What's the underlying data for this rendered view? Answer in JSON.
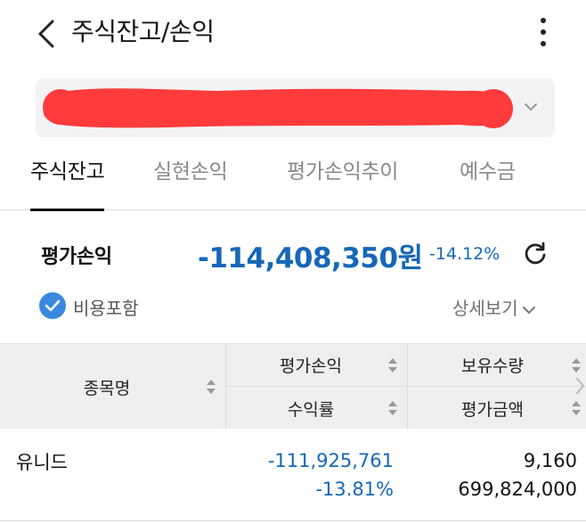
{
  "header": {
    "title": "주식잔고/손익",
    "back_icon": "chevron-left-icon",
    "more_icon": "more-vertical-icon"
  },
  "account": {
    "chevron_icon": "chevron-down-icon",
    "mask_color": "#ff3b3b"
  },
  "tabs": [
    {
      "label": "주식잔고",
      "active": true
    },
    {
      "label": "실현손익",
      "active": false
    },
    {
      "label": "평가손익추이",
      "active": false
    },
    {
      "label": "예수금",
      "active": false
    }
  ],
  "summary": {
    "label": "평가손익",
    "value": "-114,408,350원",
    "rate": "-14.12%",
    "refresh_icon": "refresh-icon"
  },
  "options": {
    "include_fees_label": "비용포함",
    "include_fees_checked": true,
    "detail_label": "상세보기"
  },
  "table": {
    "columns": {
      "name": "종목명",
      "pl": "평가손익",
      "rate": "수익률",
      "quantity": "보유수량",
      "amount": "평가금액"
    },
    "rows": [
      {
        "name": "유니드",
        "pl": "-111,925,761",
        "rate": "-13.81%",
        "quantity": "9,160",
        "amount": "699,824,000"
      }
    ]
  },
  "colors": {
    "accent_blue": "#1667b7",
    "checkbox_blue": "#3b87e0",
    "header_bg": "#efefef"
  }
}
